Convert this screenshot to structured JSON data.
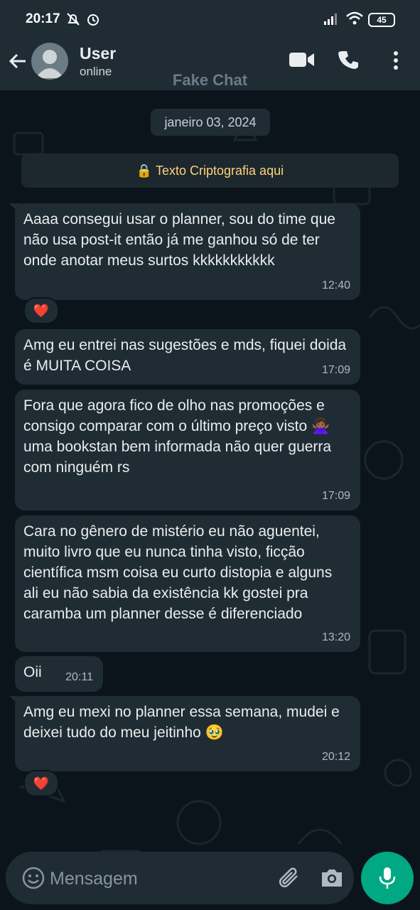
{
  "status_bar": {
    "time": "20:17",
    "battery": "45"
  },
  "header": {
    "name": "User",
    "status": "online"
  },
  "watermark": "Fake Chat",
  "date_chip": "janeiro 03, 2024",
  "encryption_banner": "🔒 Texto Criptografia aqui",
  "messages": [
    {
      "text": "Aaaa consegui usar o planner, sou do time que não usa post-it então já me ganhou só de ter onde anotar meus surtos kkkkkkkkkkk",
      "time": "12:40",
      "reaction": "❤️"
    },
    {
      "text": "Amg eu entrei nas sugestões e mds, fiquei doida é MUITA COISA",
      "time": "17:09"
    },
    {
      "text": "Fora que agora fico de olho nas promoções e consigo comparar com o último preço visto 🙅🏾‍♀️ uma bookstan bem informada não quer guerra com ninguém rs",
      "time": "17:09"
    },
    {
      "text": "Cara no gênero de mistério eu não aguentei,  muito livro que eu nunca tinha visto, ficção científica msm coisa eu curto distopia e alguns ali eu não sabia da existência kk gostei pra caramba um planner desse é diferenciado",
      "time": "13:20"
    },
    {
      "text": "Oii",
      "time": "20:11"
    },
    {
      "text": "Amg eu mexi no planner essa semana, mudei e deixei tudo do meu jeitinho 🥹",
      "time": "20:12",
      "reaction": "❤️"
    }
  ],
  "input": {
    "placeholder": "Mensagem"
  },
  "colors": {
    "bubble": "#202c33",
    "background": "#0b141a",
    "accent": "#00a884",
    "banner_text": "#ffd279"
  }
}
